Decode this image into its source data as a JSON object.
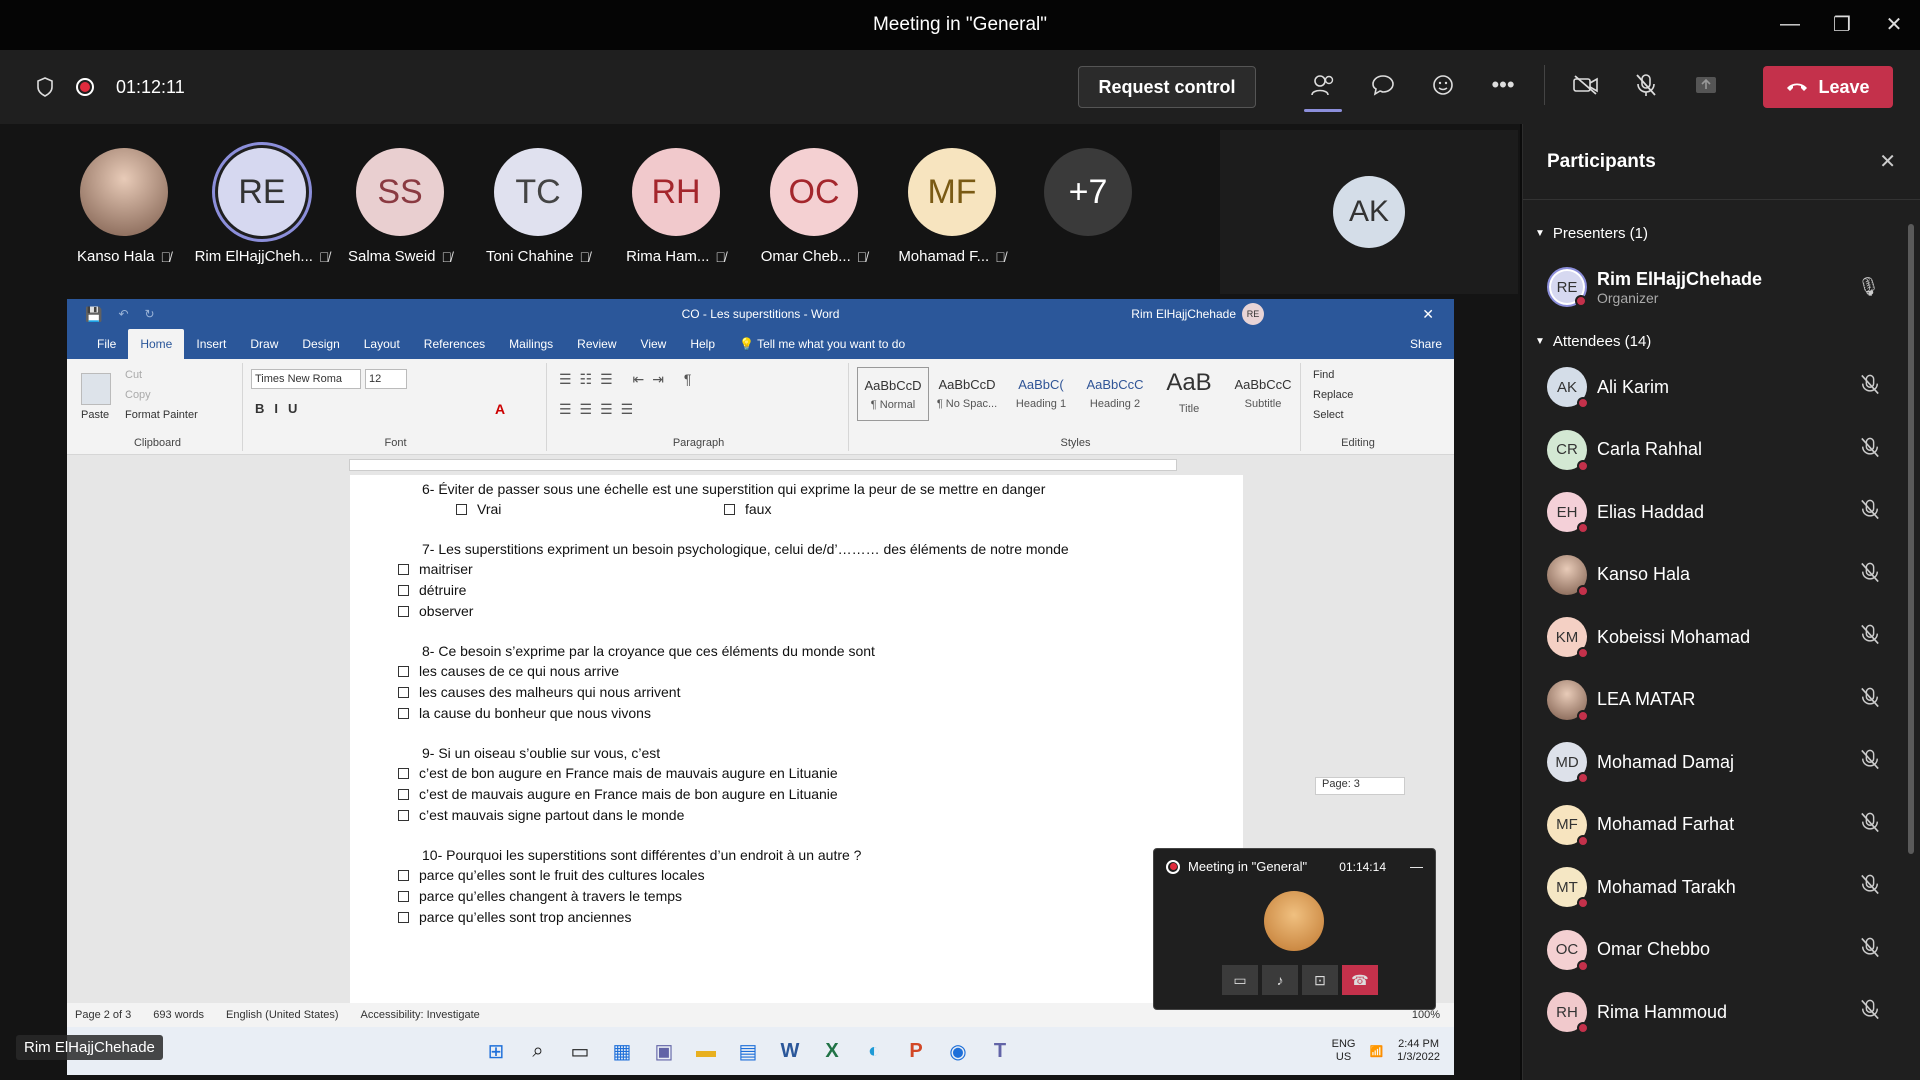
{
  "window": {
    "title": "Meeting in \"General\"",
    "min": "—",
    "restore": "❐",
    "close": "✕"
  },
  "toolbar": {
    "timer": "01:12:11",
    "request_control": "Request control",
    "leave": "Leave"
  },
  "gallery": [
    {
      "initials": "",
      "name": "Kanso Hala",
      "bg": "#c9a99a",
      "fg": "#333",
      "photo": true
    },
    {
      "initials": "RE",
      "name": "Rim ElHajjCheh...",
      "bg": "#d6d8f0",
      "fg": "#333",
      "ring": true
    },
    {
      "initials": "SS",
      "name": "Salma Sweid",
      "bg": "#e9cfd0",
      "fg": "#8a3a41"
    },
    {
      "initials": "TC",
      "name": "Toni Chahine",
      "bg": "#e0e1ef",
      "fg": "#444"
    },
    {
      "initials": "RH",
      "name": "Rima Ham...",
      "bg": "#f1c9cc",
      "fg": "#a4262c"
    },
    {
      "initials": "OC",
      "name": "Omar Cheb...",
      "bg": "#f4d0d2",
      "fg": "#a4262c"
    },
    {
      "initials": "MF",
      "name": "Mohamad F...",
      "bg": "#f7e4bf",
      "fg": "#7a5a14"
    },
    {
      "initials": "+7",
      "name": "",
      "bg": "#3a3a3a",
      "fg": "#fff"
    }
  ],
  "self_view": {
    "initials": "AK"
  },
  "word": {
    "doc_title": "CO - Les superstitions  -  Word",
    "user": "Rim ElHajjChehade",
    "user_initials": "RE",
    "tabs": [
      "File",
      "Home",
      "Insert",
      "Draw",
      "Design",
      "Layout",
      "References",
      "Mailings",
      "Review",
      "View",
      "Help"
    ],
    "tell_me": "Tell me what you want to do",
    "share": "Share",
    "clipboard": {
      "paste": "Paste",
      "cut": "Cut",
      "copy": "Copy",
      "format_painter": "Format Painter",
      "label": "Clipboard"
    },
    "font": {
      "name": "Times New Roma",
      "size": "12",
      "label": "Font"
    },
    "paragraph_label": "Paragraph",
    "styles": [
      {
        "sample": "AaBbCcD",
        "name": "¶ Normal"
      },
      {
        "sample": "AaBbCcD",
        "name": "¶ No Spac..."
      },
      {
        "sample": "AaBbC(",
        "name": "Heading 1"
      },
      {
        "sample": "AaBbCcC",
        "name": "Heading 2"
      },
      {
        "sample": "AaB",
        "name": "Title"
      },
      {
        "sample": "AaBbCcC",
        "name": "Subtitle"
      }
    ],
    "styles_label": "Styles",
    "editing": {
      "find": "Find",
      "replace": "Replace",
      "select": "Select",
      "label": "Editing"
    },
    "doc": {
      "q6": "6-   Éviter de passer sous une échelle est une superstition qui exprime la peur de se mettre en danger",
      "q6_a": "Vrai",
      "q6_b": "faux",
      "q7": "7-   Les superstitions expriment un besoin psychologique, celui de/d’……… des éléments de notre monde",
      "q7_opts": [
        "maitriser",
        "détruire",
        "observer"
      ],
      "q8": "8-   Ce besoin s’exprime par la croyance que ces éléments du monde sont",
      "q8_opts": [
        "les causes de ce qui nous arrive",
        "les causes des malheurs qui nous arrivent",
        "la cause du bonheur que nous vivons"
      ],
      "q9": "9-   Si un oiseau s’oublie sur vous, c’est",
      "q9_opts": [
        "c’est de bon augure en France mais de mauvais augure en Lituanie",
        "c’est de mauvais augure en France mais de bon augure en Lituanie",
        "c’est mauvais signe partout dans le monde"
      ],
      "q10": "10- Pourquoi les superstitions sont différentes d’un endroit à un autre ?",
      "q10_opts": [
        "parce qu’elles sont le fruit des cultures locales",
        "parce qu’elles changent à travers le temps",
        "parce qu’elles sont trop anciennes"
      ]
    },
    "page_tip": "Page: 3",
    "status": {
      "page": "Page 2 of 3",
      "words": "693 words",
      "lang": "English (United States)",
      "access": "Accessibility: Investigate",
      "zoom": "100%"
    },
    "taskbar": {
      "lang1": "ENG",
      "lang2": "US",
      "time": "2:44 PM",
      "date": "1/3/2022"
    }
  },
  "mini_meeting": {
    "title": "Meeting in \"General\"",
    "timer": "01:14:14"
  },
  "name_tag": "Rim ElHajjChehade",
  "panel": {
    "title": "Participants",
    "presenters_label": "Presenters (1)",
    "presenter": {
      "initials": "RE",
      "name": "Rim ElHajjChehade",
      "role": "Organizer"
    },
    "attendees_label": "Attendees (14)",
    "attendees": [
      {
        "initials": "AK",
        "name": "Ali Karim",
        "bg": "#d4dde8"
      },
      {
        "initials": "CR",
        "name": "Carla Rahhal",
        "bg": "#d3e8d3"
      },
      {
        "initials": "EH",
        "name": "Elias Haddad",
        "bg": "#f4d0d8"
      },
      {
        "initials": "",
        "name": "Kanso Hala",
        "bg": "#c9a99a"
      },
      {
        "initials": "KM",
        "name": "Kobeissi Mohamad",
        "bg": "#f4d0c4"
      },
      {
        "initials": "",
        "name": "LEA MATAR",
        "bg": "#e6d4c2"
      },
      {
        "initials": "MD",
        "name": "Mohamad Damaj",
        "bg": "#dde1ea"
      },
      {
        "initials": "MF",
        "name": "Mohamad Farhat",
        "bg": "#f7e4bf"
      },
      {
        "initials": "MT",
        "name": "Mohamad Tarakh",
        "bg": "#f5e7c4"
      },
      {
        "initials": "OC",
        "name": "Omar Chebbo",
        "bg": "#f4d0d2"
      },
      {
        "initials": "RH",
        "name": "Rima Hammoud",
        "bg": "#f1c9cc"
      }
    ]
  }
}
